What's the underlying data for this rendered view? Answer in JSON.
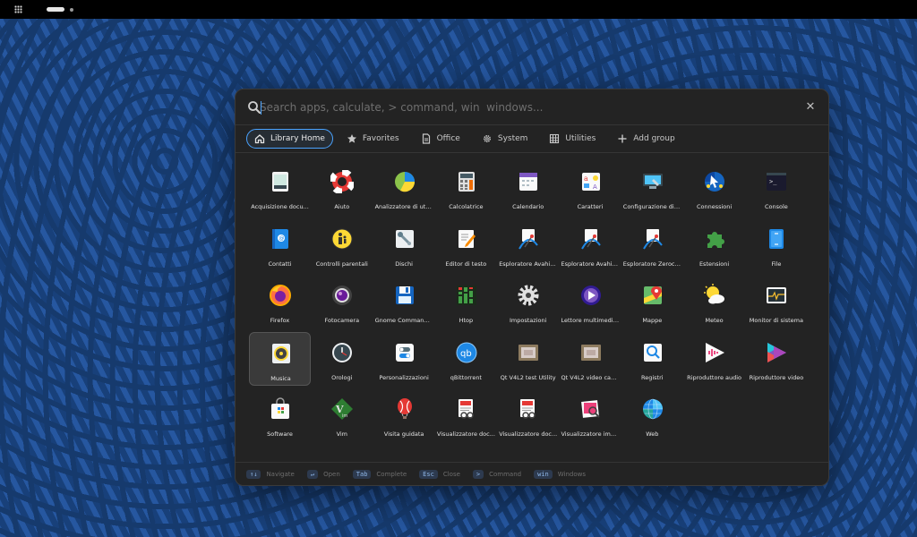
{
  "search": {
    "placeholder": "Search apps, calculate, > command, win  windows..."
  },
  "tabs": [
    {
      "label": "Library Home",
      "icon": "home-icon",
      "active": true
    },
    {
      "label": "Favorites",
      "icon": "star-icon"
    },
    {
      "label": "Office",
      "icon": "document-icon"
    },
    {
      "label": "System",
      "icon": "gear-icon"
    },
    {
      "label": "Utilities",
      "icon": "grid-icon"
    },
    {
      "label": "Add group",
      "icon": "plus-icon"
    }
  ],
  "apps": [
    {
      "label": "Acquisizione docu...",
      "icon": "scanner-icon"
    },
    {
      "label": "Aiuto",
      "icon": "lifebuoy-icon"
    },
    {
      "label": "Analizzatore di utili...",
      "icon": "pie-chart-icon"
    },
    {
      "label": "Calcolatrice",
      "icon": "calculator-icon"
    },
    {
      "label": "Calendario",
      "icon": "calendar-icon"
    },
    {
      "label": "Caratteri",
      "icon": "font-icon"
    },
    {
      "label": "Configurazione di r...",
      "icon": "remote-desktop-icon"
    },
    {
      "label": "Connessioni",
      "icon": "connections-icon"
    },
    {
      "label": "Console",
      "icon": "terminal-icon"
    },
    {
      "label": "Contatti",
      "icon": "contacts-icon"
    },
    {
      "label": "Controlli parentali",
      "icon": "parental-controls-icon"
    },
    {
      "label": "Dischi",
      "icon": "disks-icon"
    },
    {
      "label": "Editor di testo",
      "icon": "text-editor-icon"
    },
    {
      "label": "Esploratore Avahi p...",
      "icon": "avahi-icon"
    },
    {
      "label": "Esploratore Avahi p...",
      "icon": "avahi-icon"
    },
    {
      "label": "Esploratore Zeroco...",
      "icon": "avahi-icon"
    },
    {
      "label": "Estensioni",
      "icon": "puzzle-icon"
    },
    {
      "label": "File",
      "icon": "files-icon"
    },
    {
      "label": "Firefox",
      "icon": "firefox-icon"
    },
    {
      "label": "Fotocamera",
      "icon": "camera-icon"
    },
    {
      "label": "Gnome Commander",
      "icon": "floppy-icon"
    },
    {
      "label": "Htop",
      "icon": "htop-icon"
    },
    {
      "label": "Impostazioni",
      "icon": "settings-gear-icon"
    },
    {
      "label": "Lettore multimedial...",
      "icon": "media-player-icon"
    },
    {
      "label": "Mappe",
      "icon": "maps-icon"
    },
    {
      "label": "Meteo",
      "icon": "weather-icon"
    },
    {
      "label": "Monitor di sistema",
      "icon": "system-monitor-icon"
    },
    {
      "label": "Musica",
      "icon": "speaker-icon",
      "selected": true
    },
    {
      "label": "Orologi",
      "icon": "clock-icon"
    },
    {
      "label": "Personalizzazioni",
      "icon": "tweaks-icon"
    },
    {
      "label": "qBittorrent",
      "icon": "qbittorrent-icon"
    },
    {
      "label": "Qt V4L2 test Utility",
      "icon": "webcam-icon"
    },
    {
      "label": "Qt V4L2 video cap...",
      "icon": "webcam-icon"
    },
    {
      "label": "Registri",
      "icon": "logs-icon"
    },
    {
      "label": "Riproduttore audio",
      "icon": "audio-player-icon"
    },
    {
      "label": "Riproduttore video",
      "icon": "video-player-icon"
    },
    {
      "label": "Software",
      "icon": "software-bag-icon"
    },
    {
      "label": "Vim",
      "icon": "vim-icon"
    },
    {
      "label": "Visita guidata",
      "icon": "balloon-icon"
    },
    {
      "label": "Visualizzatore doc...",
      "icon": "document-viewer-icon"
    },
    {
      "label": "Visualizzatore doc...",
      "icon": "document-viewer-icon"
    },
    {
      "label": "Visualizzatore imm...",
      "icon": "image-viewer-icon"
    },
    {
      "label": "Web",
      "icon": "globe-icon"
    }
  ],
  "footer": [
    {
      "key": "↑↓",
      "label": "Navigate"
    },
    {
      "key": "↵",
      "label": "Open"
    },
    {
      "key": "Tab",
      "label": "Complete"
    },
    {
      "key": "Esc",
      "label": "Close"
    },
    {
      "key": ">",
      "label": "Command"
    },
    {
      "key": "win",
      "label": "Windows"
    }
  ],
  "colors": {
    "accent": "#4aa3ff",
    "panel": "#232323",
    "wallpaper": "#1f4d8a"
  }
}
